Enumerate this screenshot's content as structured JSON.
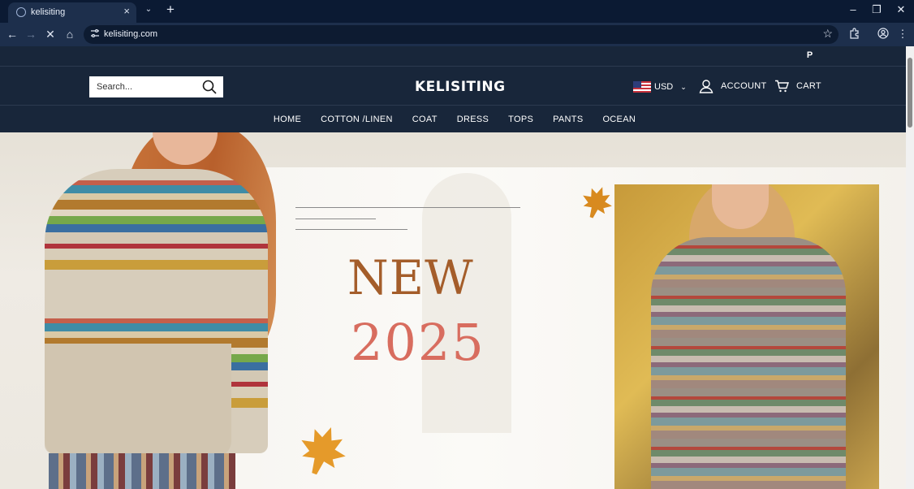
{
  "browser": {
    "tab_title": "kelisiting",
    "url": "kelisiting.com",
    "tab_close": "×",
    "new_tab": "+",
    "tab_search": "⌄",
    "win_minimize": "–",
    "win_restore": "❐",
    "win_close": "✕",
    "back": "←",
    "forward": "→",
    "stop": "✕",
    "home": "⌂",
    "bookmark": "☆",
    "menu": "⋮"
  },
  "site": {
    "social": {
      "pinterest": "P"
    },
    "search": {
      "placeholder": "Search..."
    },
    "logo": "KELISITING",
    "currency": {
      "code": "USD",
      "chevron": "⌄"
    },
    "account_label": "ACCOUNT",
    "cart_label": "CART",
    "nav": [
      "HOME",
      "COTTON /LINEN",
      "COAT",
      "DRESS",
      "TOPS",
      "PANTS",
      "OCEAN"
    ],
    "hero": {
      "headline": "NEW",
      "year": "2025"
    }
  },
  "colors": {
    "header_bg": "#18263a",
    "browser_bg": "#0b1a33",
    "headline": "#a45d2a",
    "year": "#d86d5f"
  }
}
